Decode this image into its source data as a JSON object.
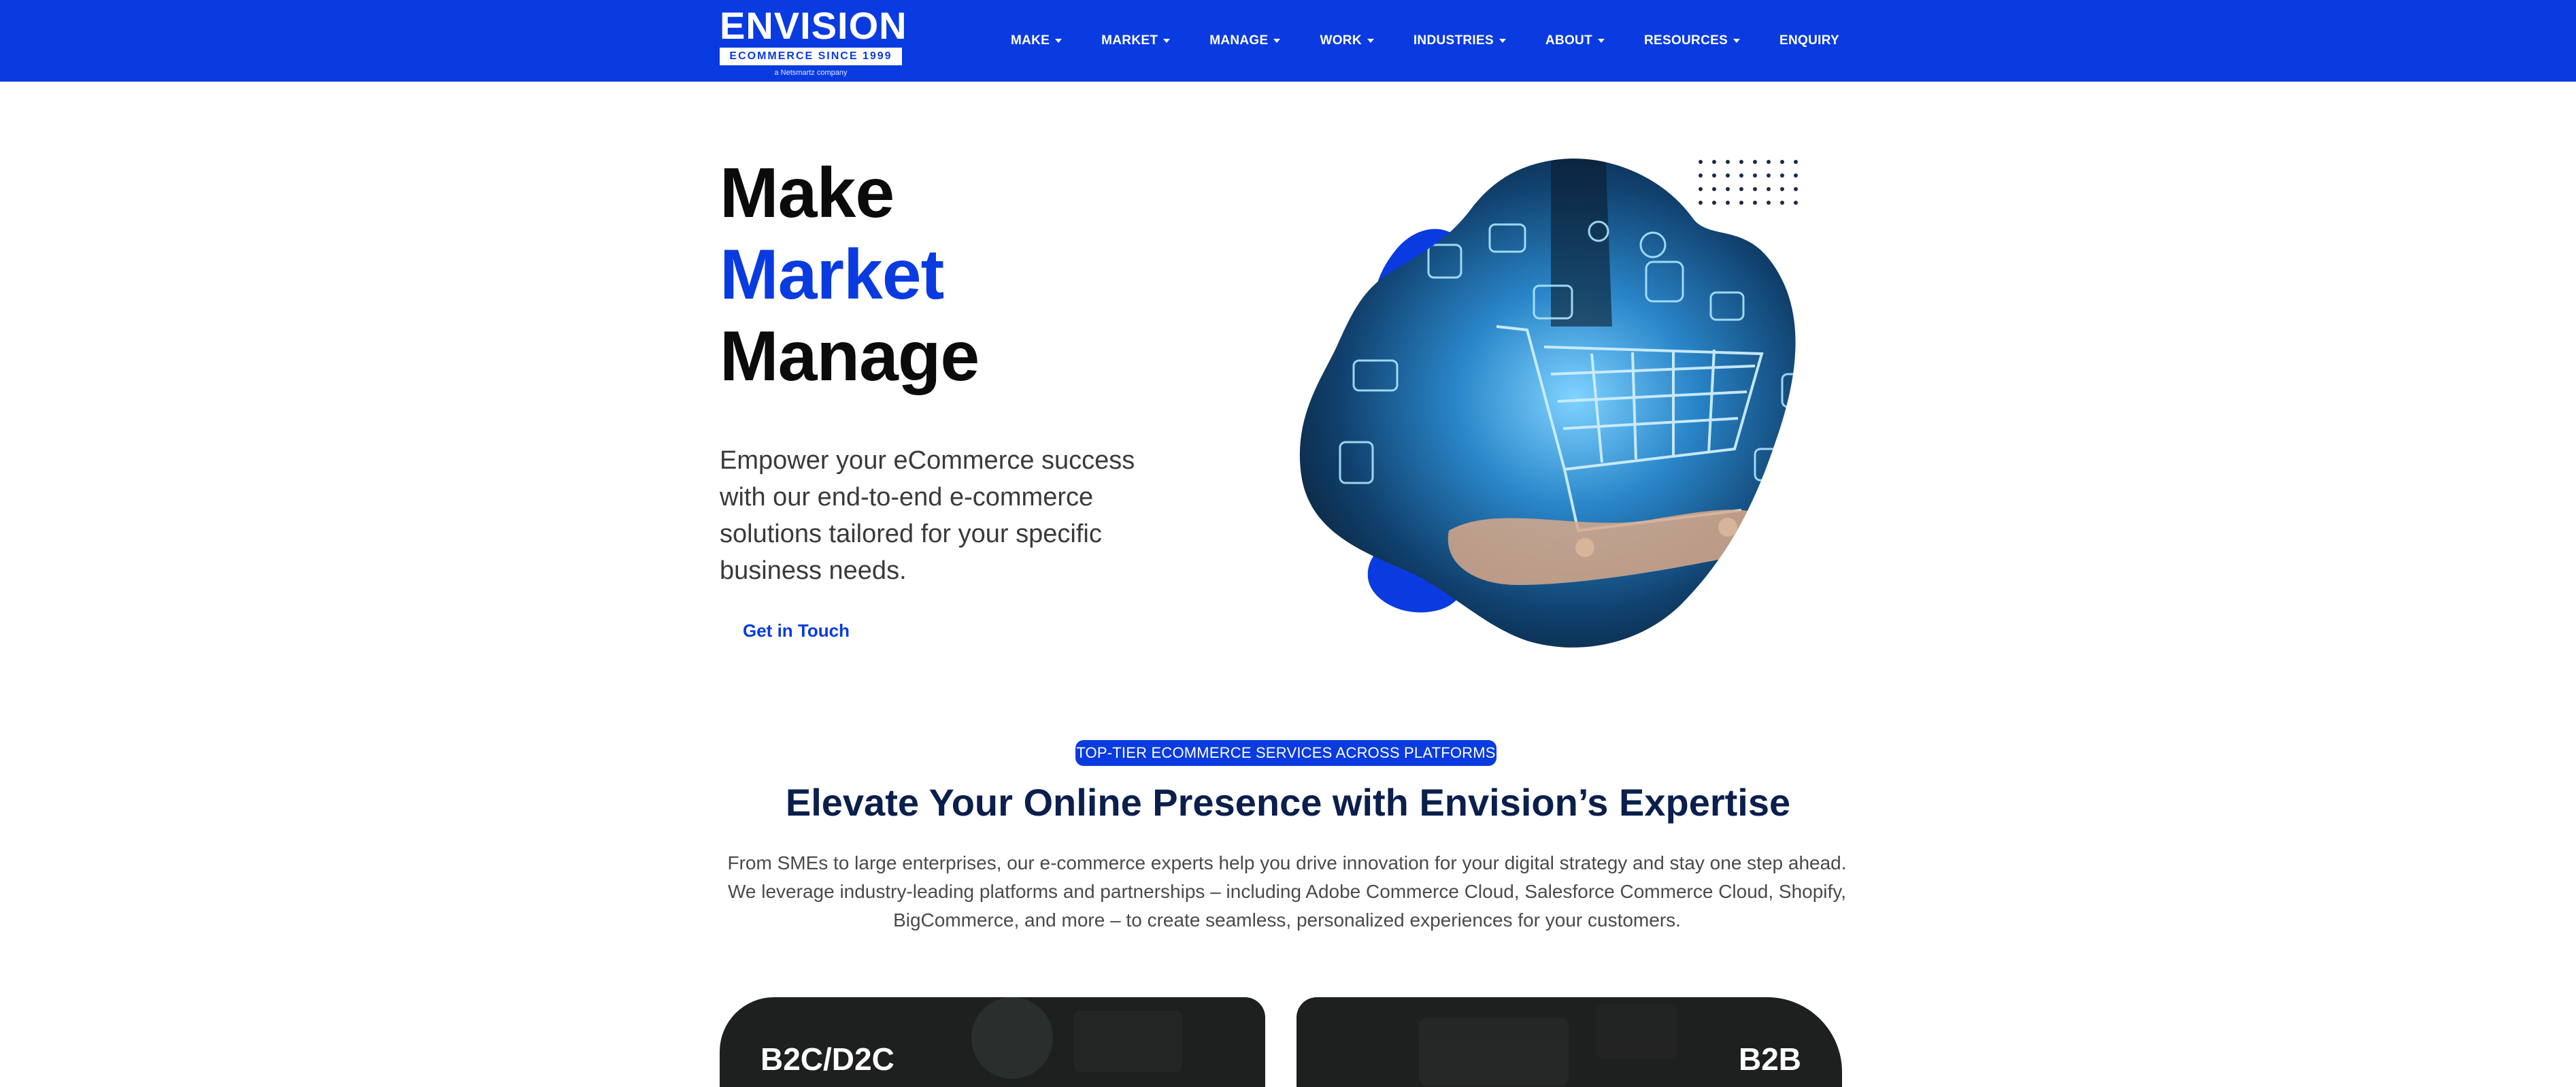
{
  "brand": {
    "name": "ENVISION",
    "tagline": "ECOMMERCE SINCE 1999",
    "sub": "a Netsmartz company",
    "color": "#0a3be0"
  },
  "nav": {
    "items": [
      {
        "label": "MAKE",
        "dropdown": true
      },
      {
        "label": "MARKET",
        "dropdown": true
      },
      {
        "label": "MANAGE",
        "dropdown": true
      },
      {
        "label": "WORK",
        "dropdown": true
      },
      {
        "label": "INDUSTRIES",
        "dropdown": true
      },
      {
        "label": "ABOUT",
        "dropdown": true
      },
      {
        "label": "RESOURCES",
        "dropdown": true
      },
      {
        "label": "ENQUIRY",
        "dropdown": false
      }
    ]
  },
  "hero": {
    "line1": "Make",
    "line2": "Market",
    "line3": "Manage",
    "description": "Empower your eCommerce success with our end-to-end e-commerce solutions tailored for your specific business needs.",
    "cta": "Get in Touch",
    "image": "hand-holding-shopping-cart-illustration"
  },
  "services": {
    "badge": "TOP-TIER ECOMMERCE SERVICES ACROSS PLATFORMS",
    "title": "Elevate Your Online Presence with Envision’s Expertise",
    "description": "From SMEs to large enterprises, our e-commerce experts help you drive innovation for your digital strategy and stay one step ahead. We leverage industry-leading platforms and partnerships – including Adobe Commerce Cloud, Salesforce Commerce Cloud, Shopify, BigCommerce, and more – to create seamless, personalized experiences for your customers."
  },
  "cards": [
    {
      "title": "B2C/D2C"
    },
    {
      "title": "B2B"
    }
  ]
}
